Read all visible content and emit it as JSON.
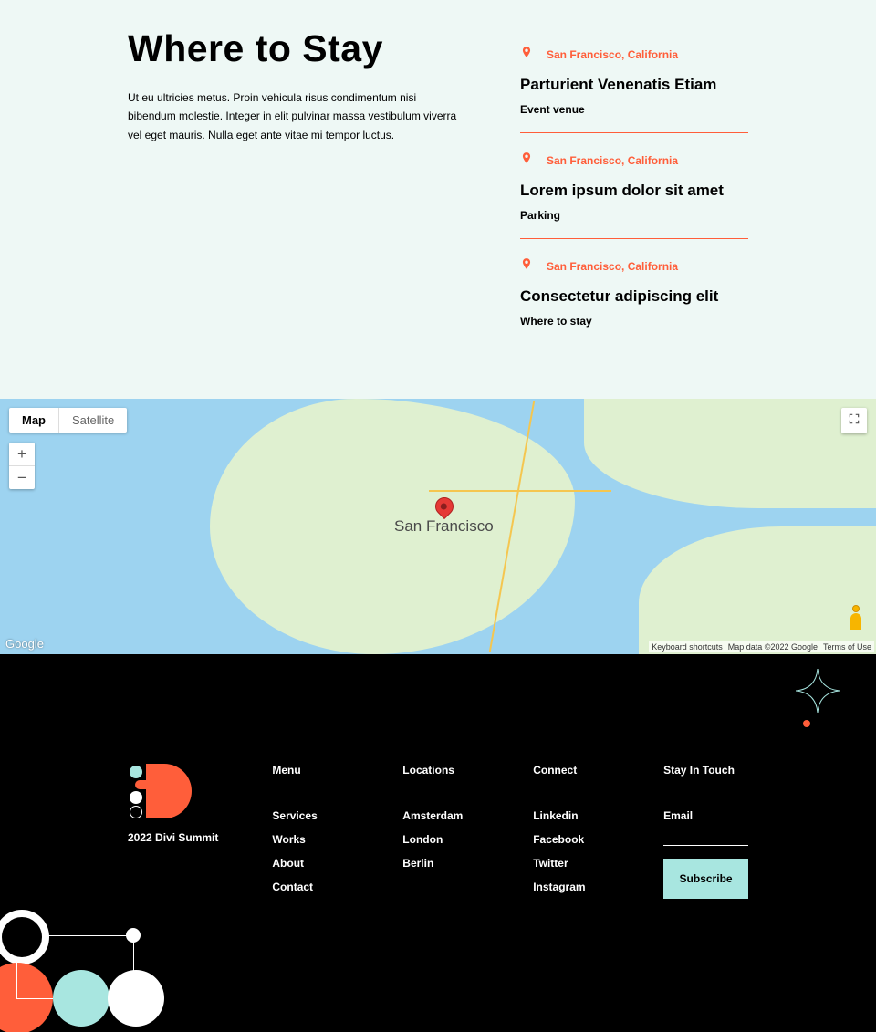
{
  "top": {
    "heading": "Where to Stay",
    "desc": "Ut eu ultricies metus. Proin vehicula risus condimentum nisi bibendum molestie. Integer in elit pulvinar massa vestibulum viverra vel eget mauris. Nulla eget ante vitae mi tempor luctus."
  },
  "locations": [
    {
      "city": "San Francisco, California",
      "title": "Parturient Venenatis Etiam",
      "sub": "Event venue"
    },
    {
      "city": "San Francisco, California",
      "title": "Lorem ipsum dolor sit amet",
      "sub": "Parking"
    },
    {
      "city": "San Francisco, California",
      "title": "Consectetur adipiscing elit",
      "sub": "Where to stay"
    }
  ],
  "map": {
    "type_map": "Map",
    "type_sat": "Satellite",
    "zoom_in": "+",
    "zoom_out": "−",
    "center_label": "San Francisco",
    "attrib_shortcuts": "Keyboard shortcuts",
    "attrib_data": "Map data ©2022 Google",
    "attrib_terms": "Terms of Use",
    "google": "Google"
  },
  "footer": {
    "brand": "2022 Divi Summit",
    "menu_h": "Menu",
    "menu": [
      "Services",
      "Works",
      "About",
      "Contact"
    ],
    "loc_h": "Locations",
    "loc": [
      "Amsterdam",
      "London",
      "Berlin"
    ],
    "con_h": "Connect",
    "con": [
      "Linkedin",
      "Facebook",
      "Twitter",
      "Instagram"
    ],
    "sub_h": "Stay In Touch",
    "sub_label": "Email",
    "sub_btn": "Subscribe"
  }
}
